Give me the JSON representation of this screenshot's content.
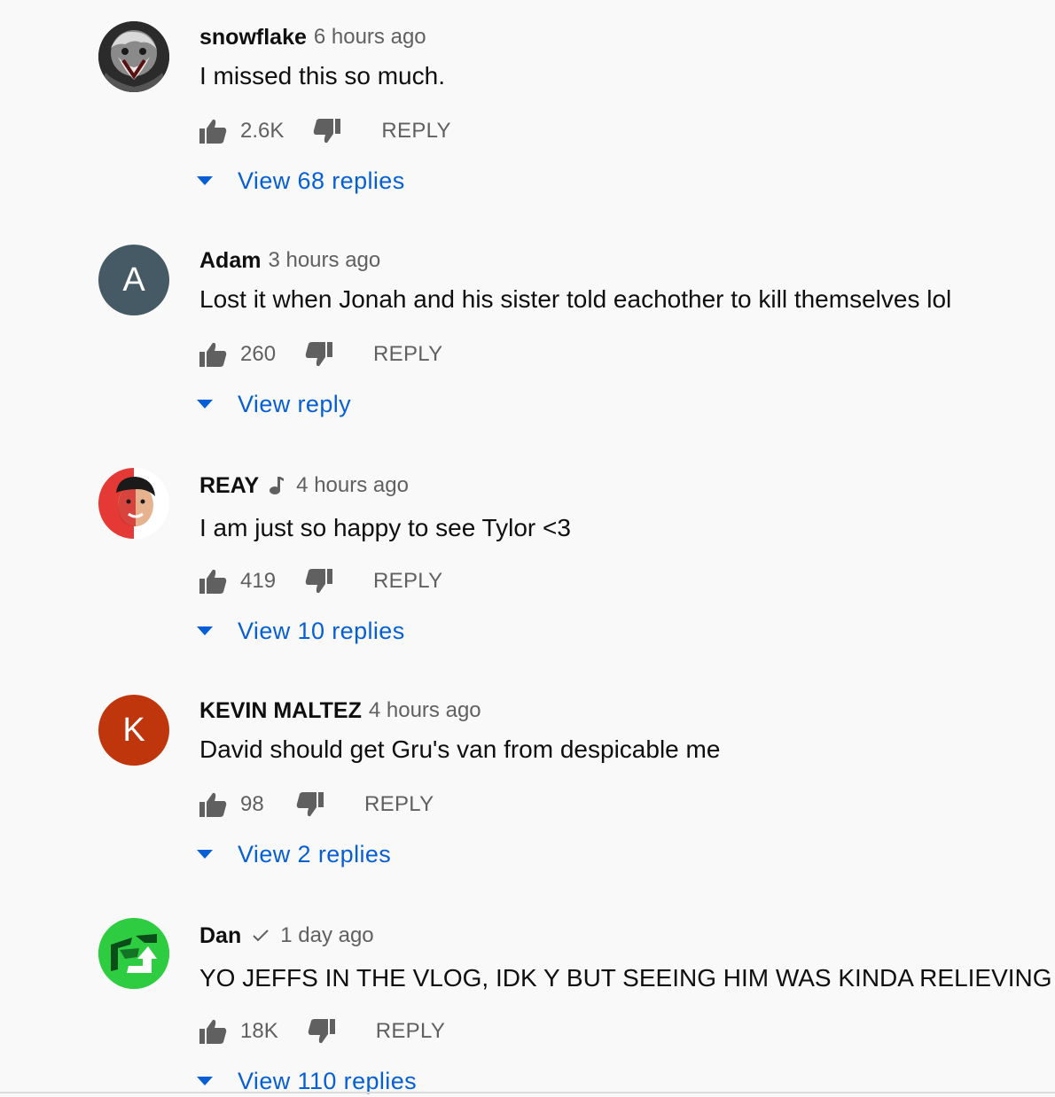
{
  "comments": [
    {
      "author": "snowflake",
      "badge": "",
      "time": "6 hours ago",
      "text": "I missed this so much.",
      "likes": "2.6K",
      "reply_label": "REPLY",
      "view_replies": "View 68 replies",
      "avatar": {
        "type": "image",
        "icon": "joker-avatar-icon"
      }
    },
    {
      "author": "Adam",
      "badge": "",
      "time": "3 hours ago",
      "text": "Lost it when Jonah and his sister told eachother to kill themselves lol",
      "likes": "260",
      "reply_label": "REPLY",
      "view_replies": "View reply",
      "avatar": {
        "type": "letter",
        "letter": "A",
        "color": "#455a64"
      }
    },
    {
      "author": "REAY",
      "badge": "music-note-icon",
      "time": "4 hours ago",
      "text": "I am just so happy to see Tylor <3",
      "likes": "419",
      "reply_label": "REPLY",
      "view_replies": "View 10 replies",
      "avatar": {
        "type": "image",
        "icon": "person-red-avatar-icon"
      }
    },
    {
      "author": "KEVIN MALTEZ",
      "badge": "",
      "time": "4 hours ago",
      "text": "David should get Gru's van from despicable me",
      "likes": "98",
      "reply_label": "REPLY",
      "view_replies": "View 2 replies",
      "avatar": {
        "type": "letter",
        "letter": "K",
        "color": "#bf360c"
      }
    },
    {
      "author": "Dan",
      "badge": "verified-check-icon",
      "time": "1 day ago",
      "text": "YO JEFFS IN THE VLOG, IDK Y BUT SEEING HIM WAS KINDA RELIEVING",
      "likes": "18K",
      "reply_label": "REPLY",
      "view_replies": "View 110 replies",
      "avatar": {
        "type": "image",
        "icon": "green-arrow-logo-icon"
      }
    }
  ],
  "colors": {
    "background": "#f9f9f9",
    "link_blue": "#065fd4",
    "secondary_text": "#606060",
    "icon_gray": "#606060"
  }
}
